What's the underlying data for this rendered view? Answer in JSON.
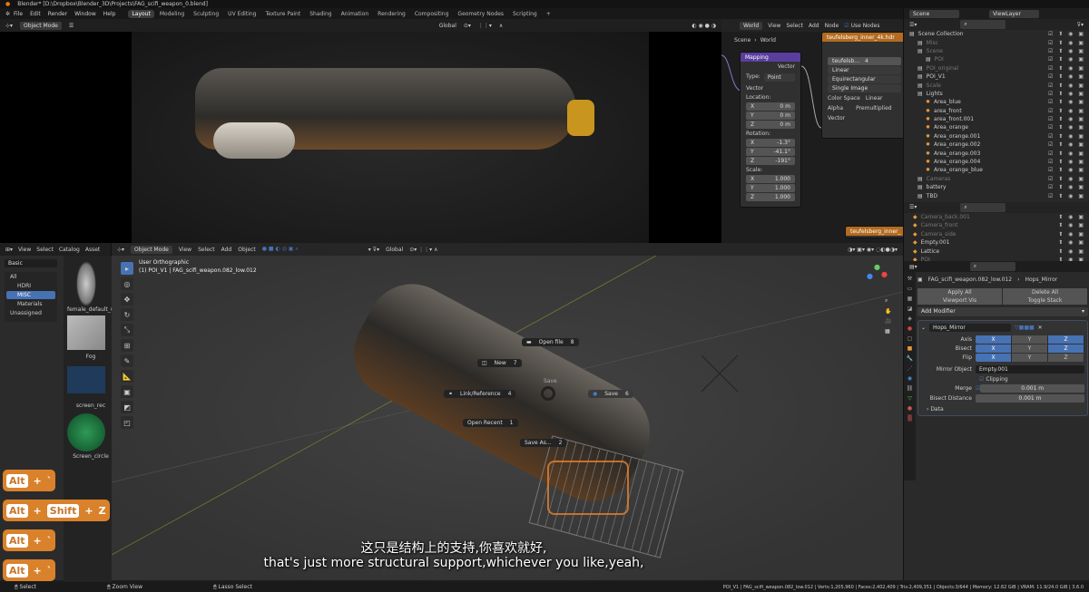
{
  "title": "Blender* [D:\\Dropbox\\Blender_3D\\Projects\\FAG_scifi_weapon_0.blend]",
  "menu": [
    "File",
    "Edit",
    "Render",
    "Window",
    "Help"
  ],
  "workspaces": [
    "Layout",
    "Modeling",
    "Sculpting",
    "UV Editing",
    "Texture Paint",
    "Shading",
    "Animation",
    "Rendering",
    "Compositing",
    "Geometry Nodes",
    "Scripting",
    "+"
  ],
  "top_viewport": {
    "mode": "Object Mode",
    "transform": "Global"
  },
  "node_editor": {
    "world_label": "World",
    "view": "View",
    "select": "Select",
    "add": "Add",
    "node": "Node",
    "use_nodes": "Use Nodes",
    "breadcrumb_scene": "Scene",
    "breadcrumb_world": "World",
    "mapping": {
      "title": "Mapping",
      "vector_out": "Vector",
      "type_label": "Type:",
      "type_value": "Point",
      "vector_in": "Vector",
      "location": "Location:",
      "loc": [
        [
          "X",
          "0 m"
        ],
        [
          "Y",
          "0 m"
        ],
        [
          "Z",
          "0 m"
        ]
      ],
      "rotation": "Rotation:",
      "rot": [
        [
          "X",
          "-1.3°"
        ],
        [
          "Y",
          "-41.1°"
        ],
        [
          "Z",
          "-191°"
        ]
      ],
      "scale": "Scale:",
      "scl": [
        [
          "X",
          "1.000"
        ],
        [
          "Y",
          "1.000"
        ],
        [
          "Z",
          "1.000"
        ]
      ]
    },
    "image": {
      "title": "teufelsberg_inner_4k.hdr",
      "name": "teufelsb...",
      "users": "4",
      "interp": "Linear",
      "proj": "Equirectangular",
      "source": "Single Image",
      "color_space_label": "Color Space",
      "color_space": "Linear",
      "alpha_label": "Alpha",
      "alpha": "Premultiplied",
      "vector": "Vector"
    },
    "image2_title": "teufelsberg_inner_"
  },
  "outliner": {
    "scene": "Scene",
    "view_layer": "ViewLayer",
    "items": [
      {
        "label": "Scene Collection",
        "dim": false,
        "indent": 0
      },
      {
        "label": "Misc",
        "dim": true,
        "indent": 1
      },
      {
        "label": "Scene",
        "dim": true,
        "indent": 1
      },
      {
        "label": "POI",
        "dim": true,
        "indent": 2
      },
      {
        "label": "POI_original",
        "dim": true,
        "indent": 1
      },
      {
        "label": "POI_V1",
        "dim": false,
        "indent": 1
      },
      {
        "label": "Scale",
        "dim": true,
        "indent": 1
      },
      {
        "label": "Lights",
        "dim": false,
        "indent": 1
      },
      {
        "label": "Area_blue",
        "dim": false,
        "indent": 2
      },
      {
        "label": "area_front",
        "dim": false,
        "indent": 2
      },
      {
        "label": "area_front.001",
        "dim": false,
        "indent": 2
      },
      {
        "label": "Area_orange",
        "dim": false,
        "indent": 2
      },
      {
        "label": "Area_orange.001",
        "dim": false,
        "indent": 2
      },
      {
        "label": "Area_orange.002",
        "dim": false,
        "indent": 2
      },
      {
        "label": "Area_orange.003",
        "dim": false,
        "indent": 2
      },
      {
        "label": "Area_orange.004",
        "dim": false,
        "indent": 2
      },
      {
        "label": "Area_orange_blue",
        "dim": false,
        "indent": 2
      },
      {
        "label": "Cameras",
        "dim": true,
        "indent": 1
      },
      {
        "label": "battery",
        "dim": false,
        "indent": 1
      },
      {
        "label": "TBD",
        "dim": false,
        "indent": 1
      }
    ],
    "items2": [
      {
        "label": "Camera_back.001",
        "dim": true
      },
      {
        "label": "Camera_front",
        "dim": true
      },
      {
        "label": "Camera_side",
        "dim": true
      },
      {
        "label": "Empty.001",
        "dim": false
      },
      {
        "label": "Lattice",
        "dim": false
      },
      {
        "label": "POI",
        "dim": true
      }
    ]
  },
  "properties": {
    "object": "FAG_scifi_weapon.082_low.012",
    "modifier_crumb": "Hops_Mirror",
    "apply_all": "Apply All",
    "delete_all": "Delete All",
    "viewport_vis": "Viewport Vis",
    "toggle_stack": "Toggle Stack",
    "add_modifier": "Add Modifier",
    "modifier": {
      "name": "Hops_Mirror",
      "axis": "Axis",
      "bisect": "Bisect",
      "flip": "Flip",
      "xyz": [
        "X",
        "Y",
        "Z"
      ],
      "axis_on": [
        true,
        false,
        true
      ],
      "bisect_on": [
        true,
        false,
        true
      ],
      "flip_on": [
        true,
        false,
        false
      ],
      "mirror_object_label": "Mirror Object",
      "mirror_object": "Empty.001",
      "clipping": "Clipping",
      "merge_label": "Merge",
      "merge": "0.001 m",
      "bisect_distance_label": "Bisect Distance",
      "bisect_distance": "0.001 m",
      "data": "Data"
    }
  },
  "asset_browser": {
    "view": "View",
    "select": "Select",
    "catalog": "Catalog",
    "asset": "Asset",
    "library": "Basic",
    "catalogs": [
      "All",
      "HDRI",
      "MISC",
      "Materials",
      "Unassigned"
    ],
    "assets": [
      "female_default_w...",
      "Fog",
      "screen_rec",
      "Screen_circle"
    ]
  },
  "viewport": {
    "mode": "Object Mode",
    "view": "View",
    "select": "Select",
    "add": "Add",
    "object": "Object",
    "transform": "Global",
    "view_name": "User Orthographic",
    "context": "(1) POI_V1 | FAG_scifi_weapon.082_low.012"
  },
  "pie_menu": {
    "title": "Save",
    "items": [
      {
        "label": "Open file",
        "key": "8"
      },
      {
        "label": "New",
        "key": "7"
      },
      {
        "label": "Link/Reference",
        "key": "4"
      },
      {
        "label": "Save",
        "key": "6"
      },
      {
        "label": "Open Recent",
        "key": "1"
      },
      {
        "label": "Save As...",
        "key": "2"
      }
    ]
  },
  "keys": [
    [
      "Alt",
      "+",
      "`"
    ],
    [
      "Alt",
      "+",
      "Shift",
      "+",
      "Z"
    ],
    [
      "Alt",
      "+",
      "`"
    ],
    [
      "Alt",
      "+",
      "`"
    ]
  ],
  "subtitles": {
    "zh": "这只是结构上的支持,你喜欢就好,",
    "en": "that's just more structural support,whichever you like,yeah,"
  },
  "status": {
    "select": "Select",
    "zoom": "Zoom View",
    "lasso": "Lasso Select",
    "stats": "POI_V1 | FAG_scifi_weapon.082_low.012 | Verts:1,205,960 | Faces:2,402,409 | Tris:2,409,351 | Objects:3/644 | Memory: 12.62 GiB | VRAM: 11.9/24.0 GiB | 3.6.0"
  },
  "colors": {
    "accent": "#4772b3",
    "mapping_header": "#5a3e9e",
    "image_header": "#b36b1f",
    "key_badge": "#d9822b"
  }
}
